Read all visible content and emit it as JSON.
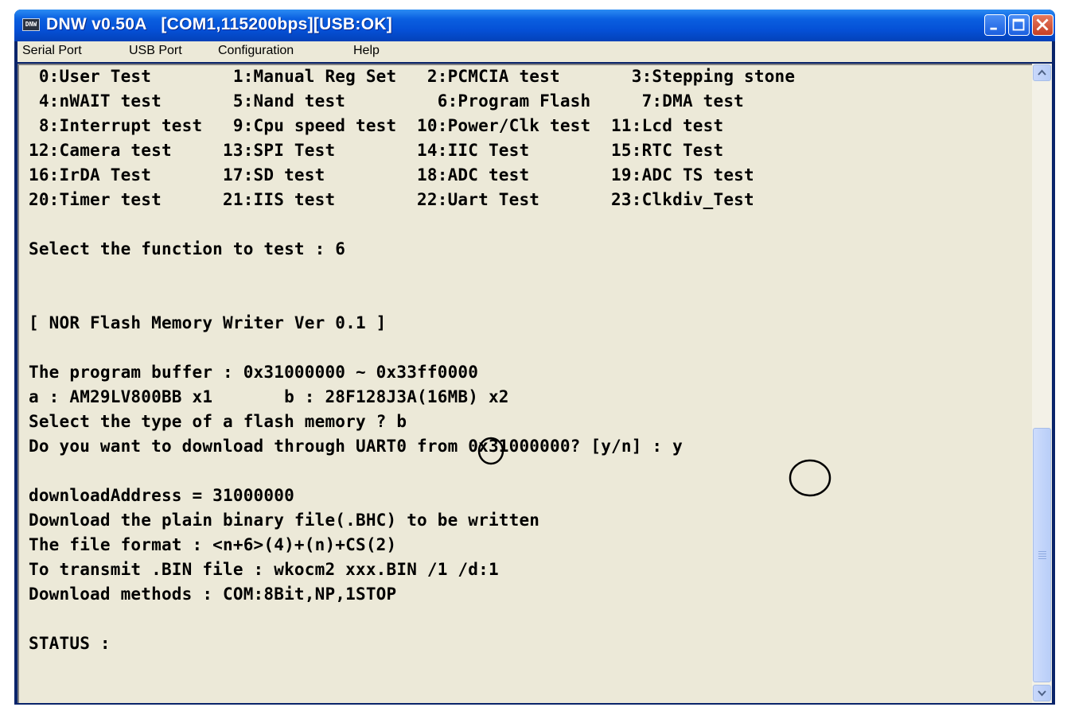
{
  "window": {
    "title": "DNW v0.50A   [COM1,115200bps][USB:OK]",
    "icon_text": "DNW"
  },
  "menu": [
    "Serial Port",
    "USB Port",
    "Configuration",
    "Help"
  ],
  "terminal": {
    "lines": [
      " 0:User Test        1:Manual Reg Set   2:PCMCIA test       3:Stepping stone",
      " 4:nWAIT test       5:Nand test         6:Program Flash     7:DMA test",
      " 8:Interrupt test   9:Cpu speed test  10:Power/Clk test  11:Lcd test",
      "12:Camera test     13:SPI Test        14:IIC Test        15:RTC Test",
      "16:IrDA Test       17:SD test         18:ADC test        19:ADC TS test",
      "20:Timer test      21:IIS test        22:Uart Test       23:Clkdiv_Test",
      "",
      "Select the function to test : 6",
      "",
      "",
      "[ NOR Flash Memory Writer Ver 0.1 ]",
      "",
      "The program buffer : 0x31000000 ~ 0x33ff0000",
      "a : AM29LV800BB x1       b : 28F128J3A(16MB) x2",
      "Select the type of a flash memory ? b",
      "Do you want to download through UART0 from 0x31000000? [y/n] : y",
      "",
      "downloadAddress = 31000000",
      "Download the plain binary file(.BHC) to be written",
      "The file format : <n+6>(4)+(n)+CS(2)",
      "To transmit .BIN file : wkocm2 xxx.BIN /1 /d:1",
      "Download methods : COM:8Bit,NP,1STOP",
      "",
      "STATUS :"
    ]
  },
  "icons": {
    "minimize": "minimize-icon",
    "maximize": "maximize-icon",
    "close": "close-icon",
    "scroll_up": "scroll-up-arrow-icon",
    "scroll_down": "scroll-down-arrow-icon"
  },
  "colors": {
    "titlebar": "#0550d6",
    "terminal_bg": "#ece9d8",
    "close_button": "#c53f23"
  }
}
